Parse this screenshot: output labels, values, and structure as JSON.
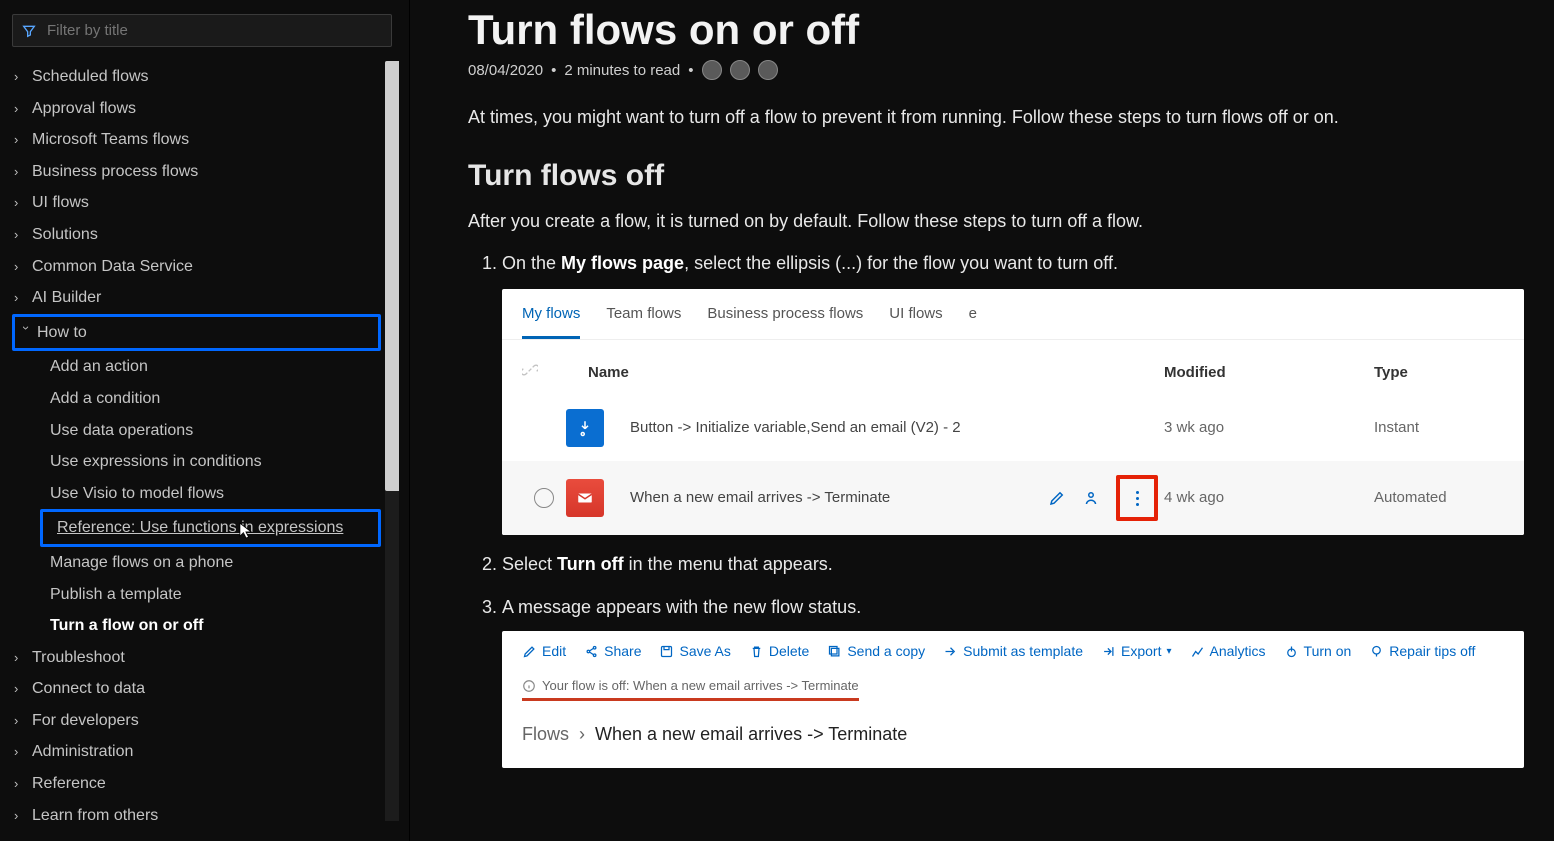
{
  "sidebar": {
    "filter_placeholder": "Filter by title",
    "items": [
      {
        "label": "Scheduled flows",
        "chev": ">"
      },
      {
        "label": "Approval flows",
        "chev": ">"
      },
      {
        "label": "Microsoft Teams flows",
        "chev": ">"
      },
      {
        "label": "Business process flows",
        "chev": ">"
      },
      {
        "label": "UI flows",
        "chev": ">"
      },
      {
        "label": "Solutions",
        "chev": ">"
      },
      {
        "label": "Common Data Service",
        "chev": ">"
      },
      {
        "label": "AI Builder",
        "chev": ">"
      }
    ],
    "howto_label": "How to",
    "howto_children": [
      {
        "label": "Add an action"
      },
      {
        "label": "Add a condition"
      },
      {
        "label": "Use data operations"
      },
      {
        "label": "Use expressions in conditions"
      },
      {
        "label": "Use Visio to model flows"
      },
      {
        "label": "Reference: Use functions in expressions",
        "highlight": true
      },
      {
        "label": "Manage flows on a phone"
      },
      {
        "label": "Publish a template"
      },
      {
        "label": "Turn a flow on or off",
        "current": true
      }
    ],
    "after": [
      {
        "label": "Troubleshoot",
        "chev": ">"
      },
      {
        "label": "Connect to data",
        "chev": ">"
      },
      {
        "label": "For developers",
        "chev": ">"
      },
      {
        "label": "Administration",
        "chev": ">"
      },
      {
        "label": "Reference",
        "chev": ">"
      },
      {
        "label": "Learn from others",
        "chev": ">"
      }
    ]
  },
  "article": {
    "title": "Turn flows on or off",
    "date": "08/04/2020",
    "readtime": "2 minutes to read",
    "intro": "At times, you might want to turn off a flow to prevent it from running. Follow these steps to turn flows off or on.",
    "h2": "Turn flows off",
    "p1": "After you create a flow, it is turned on by default. Follow these steps to turn off a flow.",
    "step1_pre": "On the ",
    "step1_bold": "My flows page",
    "step1_post": ", select the ellipsis (...) for the flow you want to turn off.",
    "step2_pre": "Select ",
    "step2_bold": "Turn off",
    "step2_post": " in the menu that appears.",
    "step3": "A message appears with the new flow status."
  },
  "shot1": {
    "tabs": [
      "My flows",
      "Team flows",
      "Business process flows",
      "UI flows"
    ],
    "cols": {
      "name": "Name",
      "mod": "Modified",
      "type": "Type"
    },
    "rows": [
      {
        "name": "Button -> Initialize variable,Send an email (V2) - 2",
        "mod": "3 wk ago",
        "type": "Instant"
      },
      {
        "name": "When a new email arrives -> Terminate",
        "mod": "4 wk ago",
        "type": "Automated"
      }
    ]
  },
  "shot2": {
    "cmds": [
      "Edit",
      "Share",
      "Save As",
      "Delete",
      "Send a copy",
      "Submit as template",
      "Export",
      "Analytics",
      "Turn on",
      "Repair tips off"
    ],
    "offmsg": "Your flow is off: When a new email arrives -> Terminate",
    "bc_root": "Flows",
    "bc_current": "When a new email arrives -> Terminate"
  }
}
